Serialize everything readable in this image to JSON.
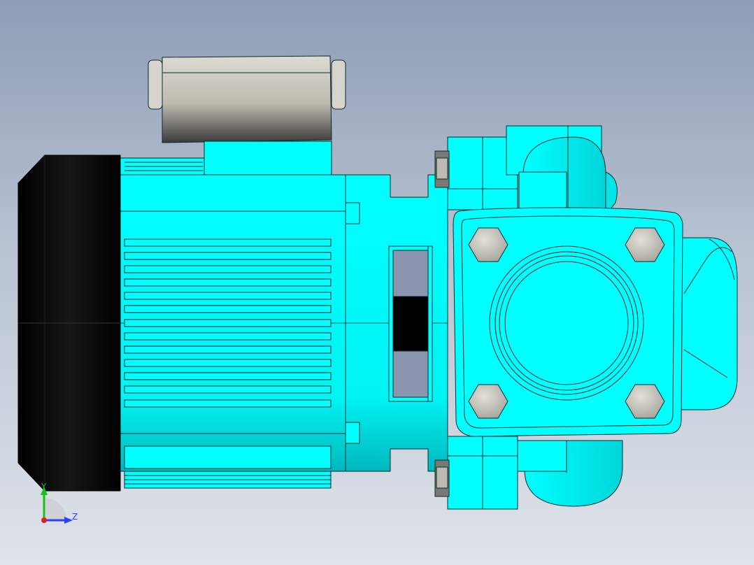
{
  "triad": {
    "y_label": "Y",
    "z_label": "Z",
    "y_color": "#19c219",
    "z_color": "#2646ff",
    "origin_color": "#e02020"
  },
  "colors": {
    "body": "#00ffff",
    "body_shadow": "#00c8cc",
    "fan_cover": "#050505",
    "bolt_head": "#c9c6bf",
    "capacitor": "#c5c2b6",
    "outline": "#102020"
  }
}
